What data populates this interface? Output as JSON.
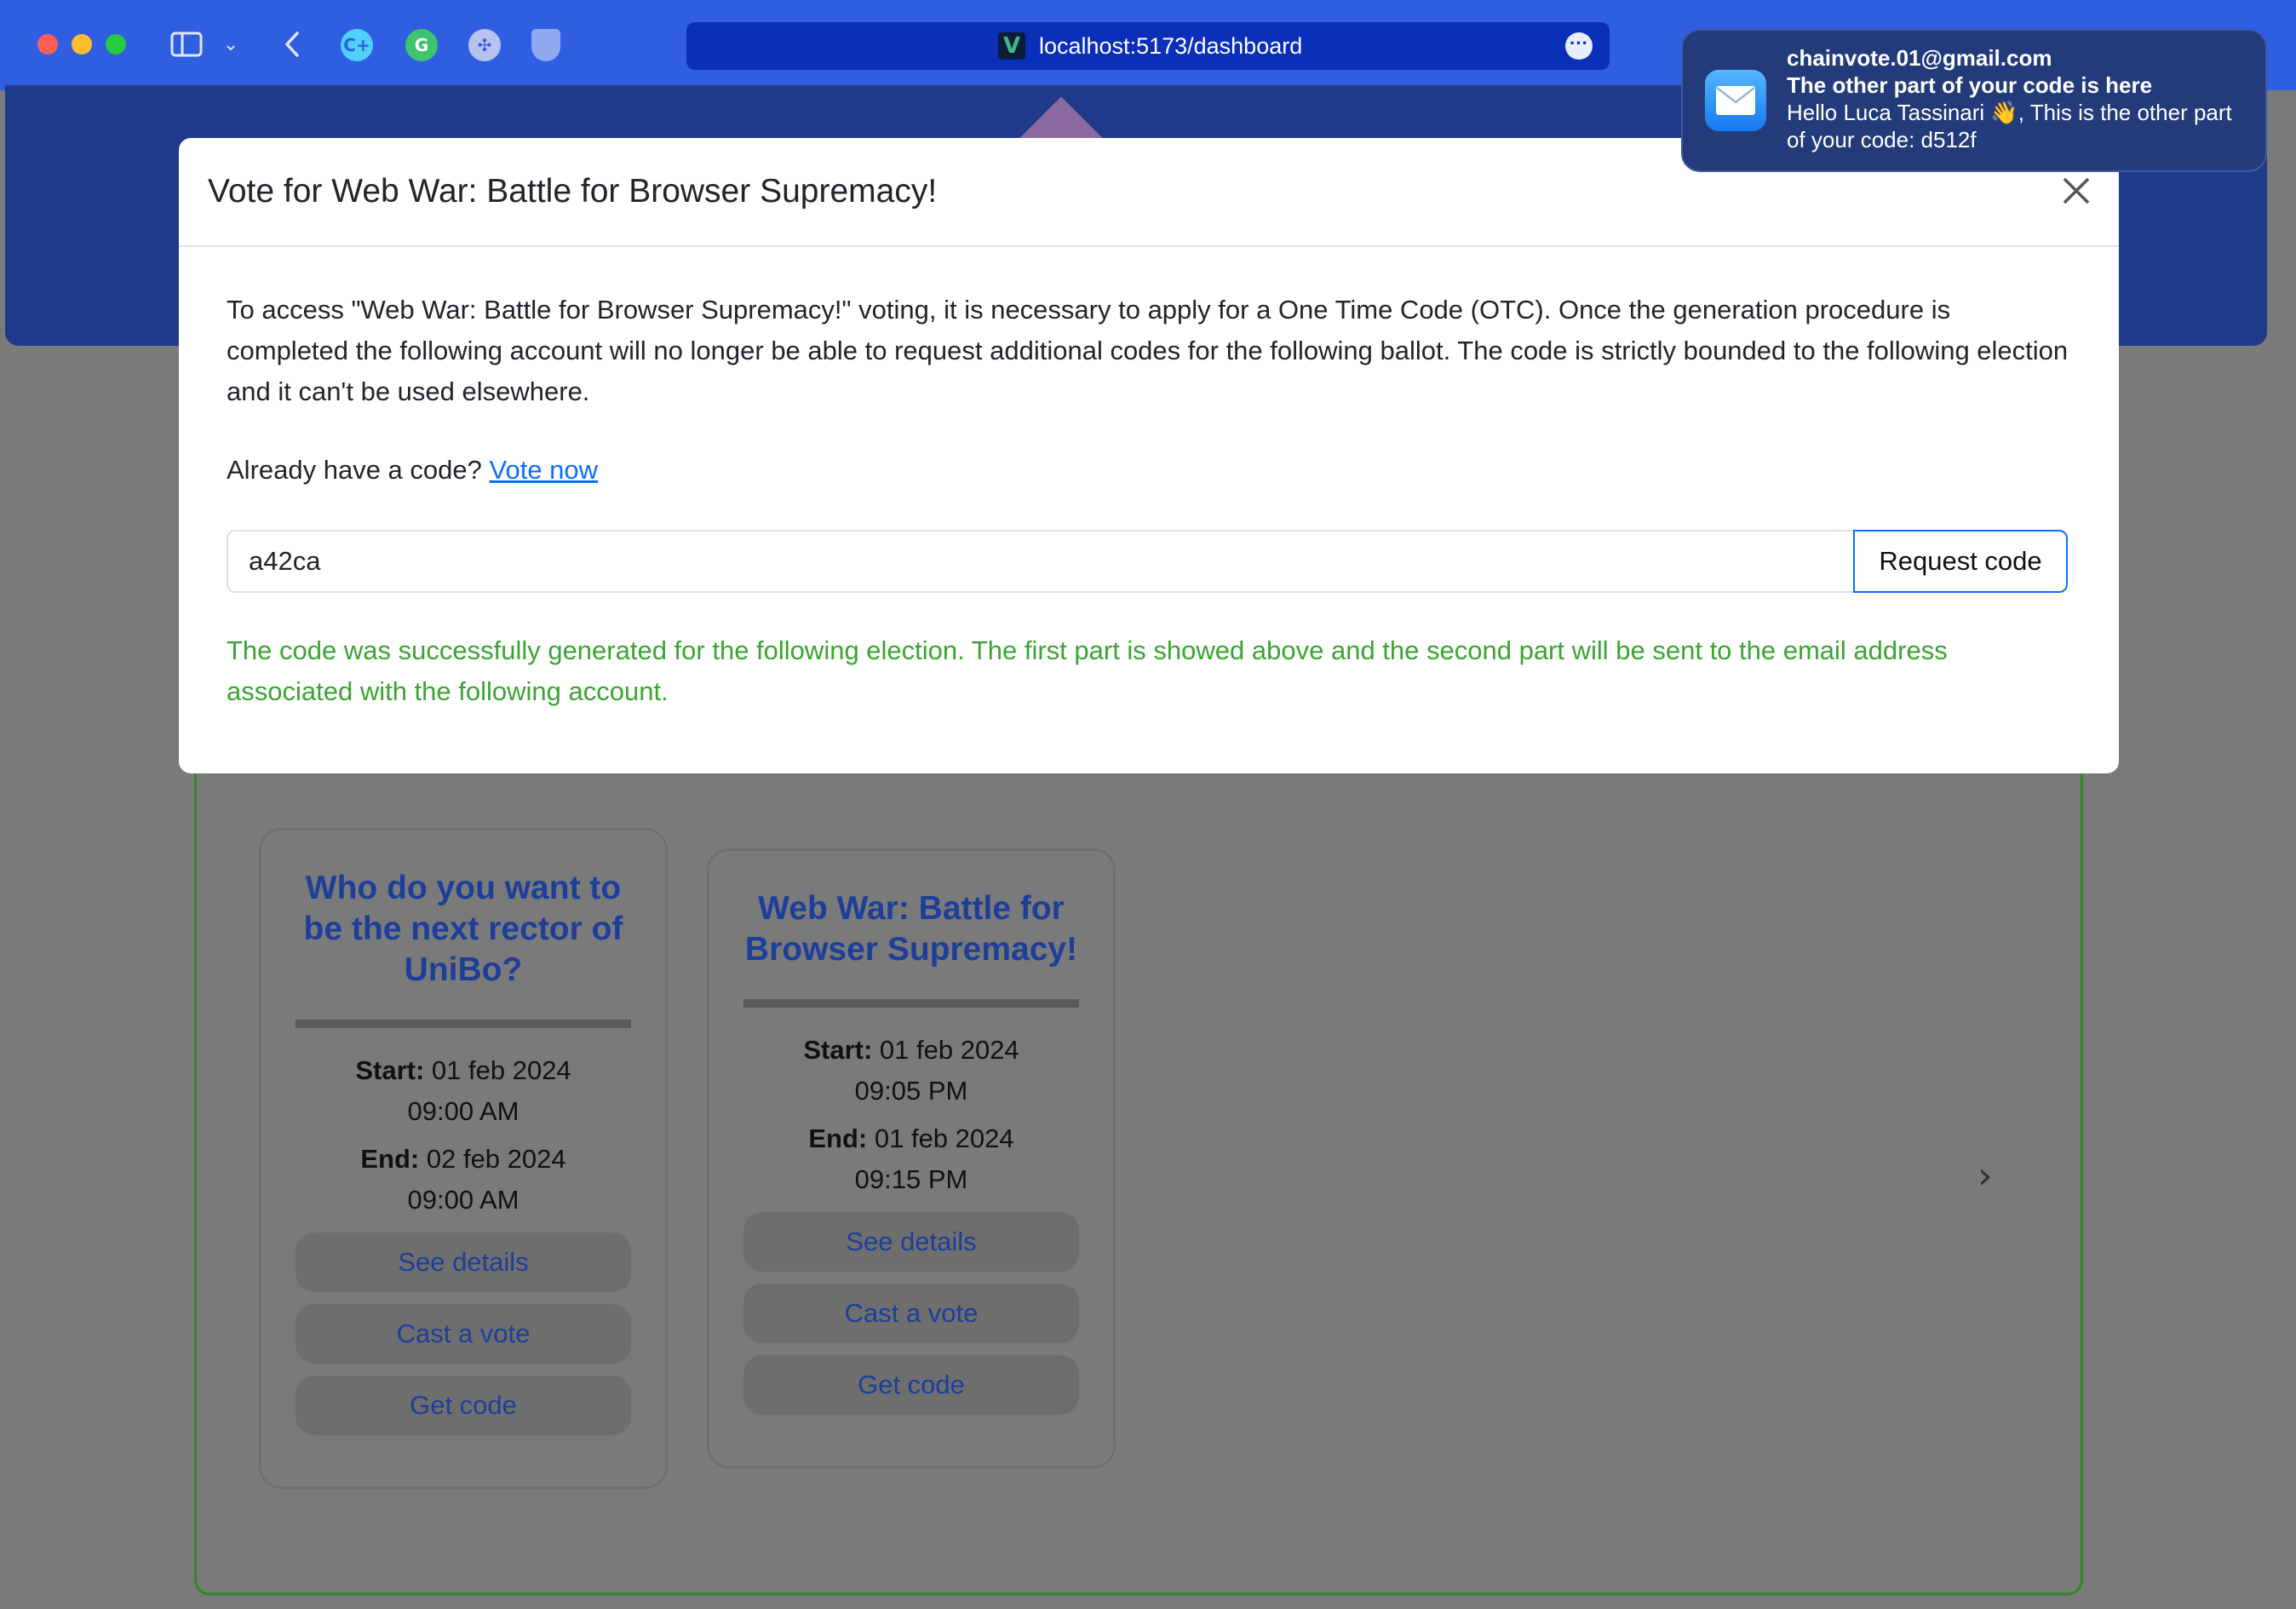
{
  "browser": {
    "url": "localhost:5173/dashboard",
    "extensions": [
      "C+",
      "G",
      "✣",
      ""
    ],
    "vite_logo": "V"
  },
  "modal": {
    "title": "Vote for Web War: Battle for Browser Supremacy!",
    "description": "To access \"Web War: Battle for Browser Supremacy!\" voting, it is necessary to apply for a One Time Code (OTC). Once the generation procedure is completed the following account will no longer be able to request additional codes for the following ballot. The code is strictly bounded to the following election and it can't be used elsewhere.",
    "already_text": "Already have a code?",
    "vote_now_link": "Vote now",
    "code_value": "a42ca",
    "request_button": "Request code",
    "success_message": "The code was successfully generated for the following election. The first part is showed above and the second part will be sent to the email address associated with the following account."
  },
  "notification": {
    "from": "chainvote.01@gmail.com",
    "subject": "The other part of your code is here",
    "body": "Hello Luca Tassinari 👋, This is the other part of your code: d512f"
  },
  "elections": [
    {
      "title": "Who do you want to be the next rector of UniBo?",
      "start_label": "Start:",
      "start_date": "01 feb 2024",
      "start_time": "09:00 AM",
      "end_label": "End:",
      "end_date": "02 feb 2024",
      "end_time": "09:00 AM",
      "details_button": "See details",
      "vote_button": "Cast a vote",
      "code_button": "Get code"
    },
    {
      "title": "Web War: Battle for Browser Supremacy!",
      "start_label": "Start:",
      "start_date": "01 feb 2024",
      "start_time": "09:05 PM",
      "end_label": "End:",
      "end_date": "01 feb 2024",
      "end_time": "09:15 PM",
      "details_button": "See details",
      "vote_button": "Cast a vote",
      "code_button": "Get code"
    }
  ],
  "carousel": {
    "prev": "‹",
    "next": "›"
  },
  "colors": {
    "chrome": "#2f5fe0",
    "hero": "#1e3a8a",
    "link": "#0d6efd",
    "success": "#3aa532",
    "card_title": "#1d3f99"
  }
}
